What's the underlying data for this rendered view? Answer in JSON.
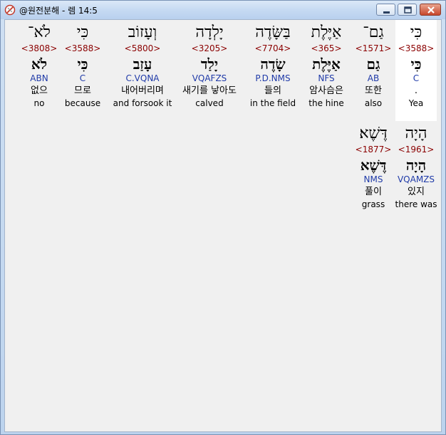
{
  "window": {
    "title": "@원전분해 - 렘 14:5"
  },
  "rows": [
    {
      "words": [
        {
          "heb": "כִּי",
          "strong": "<3588>",
          "lemma": "כִּי",
          "morph": "C",
          "korean": ".",
          "english": "Yea"
        },
        {
          "heb": "גַם־",
          "strong": "<1571>",
          "lemma": "גַם",
          "morph": "AB",
          "korean": "또한",
          "english": "also"
        },
        {
          "heb": "אַיֶּלֶת",
          "strong": "<365>",
          "lemma": "אַיֶּלֶת",
          "morph": "NFS",
          "korean": "암사슴은",
          "english": "the hine"
        },
        {
          "heb": "בַּשָּׂדֶה",
          "strong": "<7704>",
          "lemma": "שָׂדֶה",
          "morph": "P.D.NMS",
          "korean": "들의",
          "english": "in the field"
        },
        {
          "heb": "יָלְדָה",
          "strong": "<3205>",
          "lemma": "יָלַד",
          "morph": "VQAFZS",
          "korean": "새기를 낳아도",
          "english": "calved"
        },
        {
          "heb": "וְעָזוֹב",
          "strong": "<5800>",
          "lemma": "עָזַב",
          "morph": "C.VQNA",
          "korean": "내어버리며",
          "english": "and forsook it"
        },
        {
          "heb": "כִּי",
          "strong": "<3588>",
          "lemma": "כִּי",
          "morph": "C",
          "korean": "므로",
          "english": "because"
        },
        {
          "heb": "לֹא־",
          "strong": "<3808>",
          "lemma": "לֹא",
          "morph": "ABN",
          "korean": "없으",
          "english": "no"
        }
      ]
    },
    {
      "words": [
        {
          "heb": "הָיָה",
          "strong": "<1961>",
          "lemma": "הָיָה",
          "morph": "VQAMZS",
          "korean": "있지",
          "english": "there was"
        },
        {
          "heb": "דֶּשֶׁא׃",
          "strong": "<1877>",
          "lemma": "דֶּשֶׁא",
          "morph": "NMS",
          "korean": "풀이",
          "english": "grass"
        }
      ]
    }
  ]
}
